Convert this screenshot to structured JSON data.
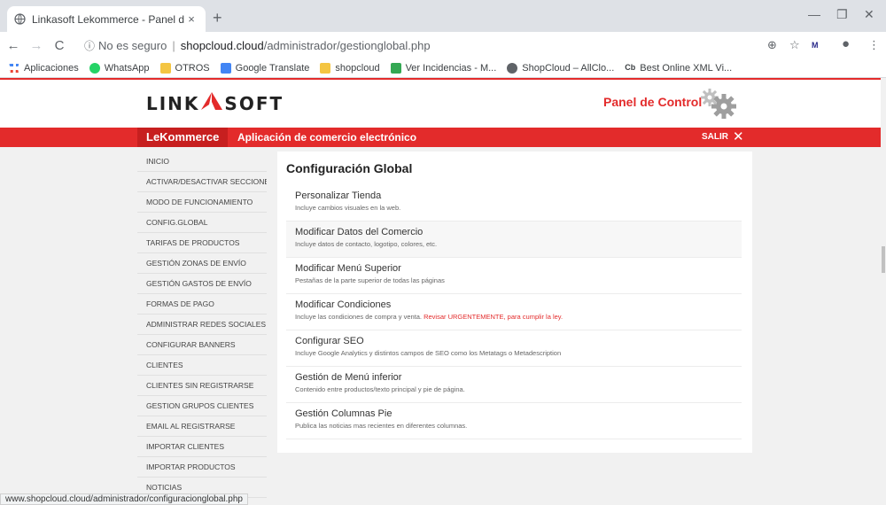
{
  "browser": {
    "tab_title": "Linkasoft Lekommerce - Panel de",
    "tab_close": "×",
    "new_tab": "+",
    "url_security": "No es seguro",
    "url_host": "shopcloud.cloud",
    "url_path": "/administrador/gestionglobal.php",
    "bookmarks": [
      {
        "label": "Aplicaciones",
        "color": "#4285f4"
      },
      {
        "label": "WhatsApp",
        "color": "#25d366"
      },
      {
        "label": "OTROS",
        "color": "#f4c542"
      },
      {
        "label": "Google Translate",
        "color": "#4285f4"
      },
      {
        "label": "shopcloud",
        "color": "#f4c542"
      },
      {
        "label": "Ver Incidencias - M...",
        "color": "#34a853"
      },
      {
        "label": "ShopCloud – AllClo...",
        "color": "#5f6368"
      },
      {
        "label": "Best Online XML Vi...",
        "color": "#333333"
      }
    ],
    "bookmark_cb": "Cb",
    "status_url": "www.shopcloud.cloud/administrador/configuracionglobal.php",
    "ext_label": "M"
  },
  "header": {
    "logo_left": "LINK",
    "logo_right": "SOFT",
    "panel_title": "Panel de Control"
  },
  "redbar": {
    "brand": "LeKommerce",
    "subtitle": "Aplicación de comercio electrónico",
    "logout": "SALIR",
    "logout_icon": "✕"
  },
  "sidebar": {
    "items": [
      "INICIO",
      "ACTIVAR/DESACTIVAR SECCIONES",
      "MODO DE FUNCIONAMIENTO",
      "CONFIG.GLOBAL",
      "TARIFAS DE PRODUCTOS",
      "GESTIÓN ZONAS DE ENVÍO",
      "GESTIÓN GASTOS DE ENVÍO",
      "FORMAS DE PAGO",
      "ADMINISTRAR REDES SOCIALES",
      "CONFIGURAR BANNERS",
      "CLIENTES",
      "CLIENTES SIN REGISTRARSE",
      "GESTION GRUPOS CLIENTES",
      "EMAIL AL REGISTRARSE",
      "IMPORTAR CLIENTES",
      "IMPORTAR PRODUCTOS",
      "NOTICIAS"
    ]
  },
  "main": {
    "title": "Configuración Global",
    "items": [
      {
        "title": "Personalizar Tienda",
        "desc": "Incluye cambios visuales en la web.",
        "warn": ""
      },
      {
        "title": "Modificar Datos del Comercio",
        "desc": "Incluye datos de contacto, logotipo, colores, etc.",
        "warn": ""
      },
      {
        "title": "Modificar Menú Superior",
        "desc": "Pestañas de la parte superior de todas las páginas",
        "warn": ""
      },
      {
        "title": "Modificar Condiciones",
        "desc": "Incluye las condiciones de compra y venta.",
        "warn": "Revisar URGENTEMENTE, para cumplir la ley."
      },
      {
        "title": "Configurar SEO",
        "desc": "Incluye Google Analytics y distintos campos de SEO como los Metatags o Metadescription",
        "warn": ""
      },
      {
        "title": "Gestión de Menú inferior",
        "desc": "Contenido entre productos/texto principal y pie de página.",
        "warn": ""
      },
      {
        "title": "Gestión Columnas Pie",
        "desc": "Publica las noticias mas recientes en diferentes columnas.",
        "warn": ""
      }
    ]
  },
  "colors": {
    "accent": "#e32b2b",
    "accent_dark": "#c71f1f"
  }
}
